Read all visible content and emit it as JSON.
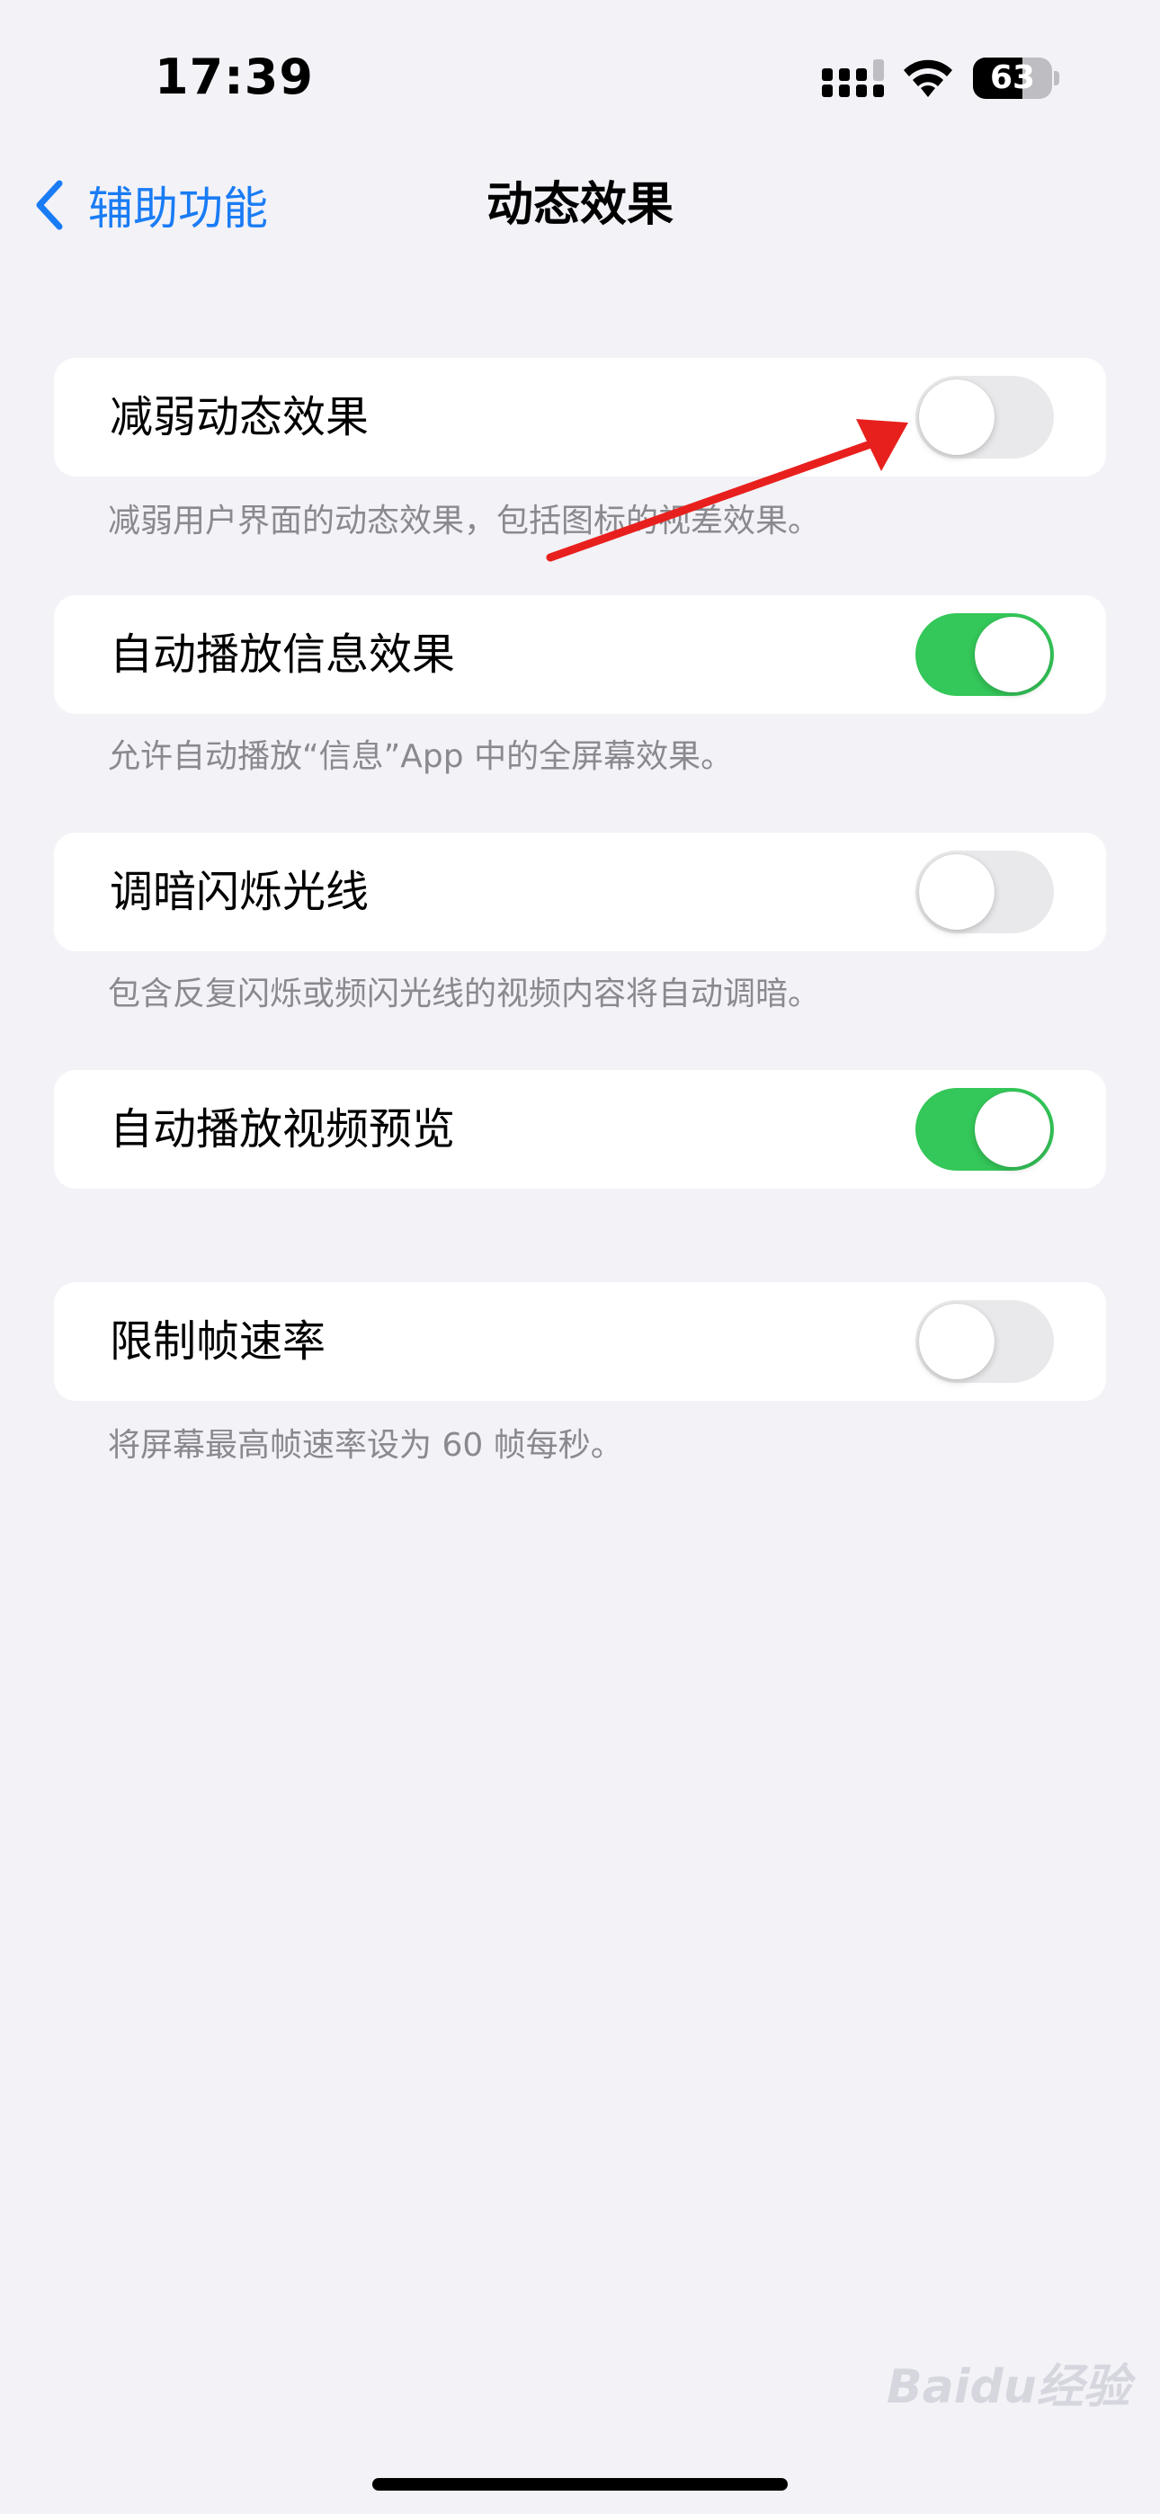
{
  "status_bar": {
    "time": "17:39",
    "battery_level": "63",
    "battery_fraction": 0.63,
    "icons": [
      "cellular-signal-icon",
      "wifi-icon",
      "battery-icon"
    ]
  },
  "nav": {
    "back_label": "辅助功能",
    "title": "动态效果",
    "back_icon": "chevron-left-icon",
    "accent_color": "#1A7CF5"
  },
  "settings": [
    {
      "label": "减弱动态效果",
      "on": false,
      "footnote": "减弱用户界面的动态效果，包括图标的视差效果。"
    },
    {
      "label": "自动播放信息效果",
      "on": true,
      "footnote": "允许自动播放“信息”App 中的全屏幕效果。"
    },
    {
      "label": "调暗闪烁光线",
      "on": false,
      "footnote": "包含反复闪烁或频闪光线的视频内容将自动调暗。"
    },
    {
      "label": "自动播放视频预览",
      "on": true
    },
    {
      "label": "限制帧速率",
      "on": false,
      "footnote": "将屏幕最高帧速率设为 60 帧每秒。"
    }
  ],
  "colors": {
    "toggle_on": "#34C759",
    "toggle_off": "#E9E9EB",
    "annotation_arrow": "#E8201D"
  },
  "watermark": "Baidu经验"
}
